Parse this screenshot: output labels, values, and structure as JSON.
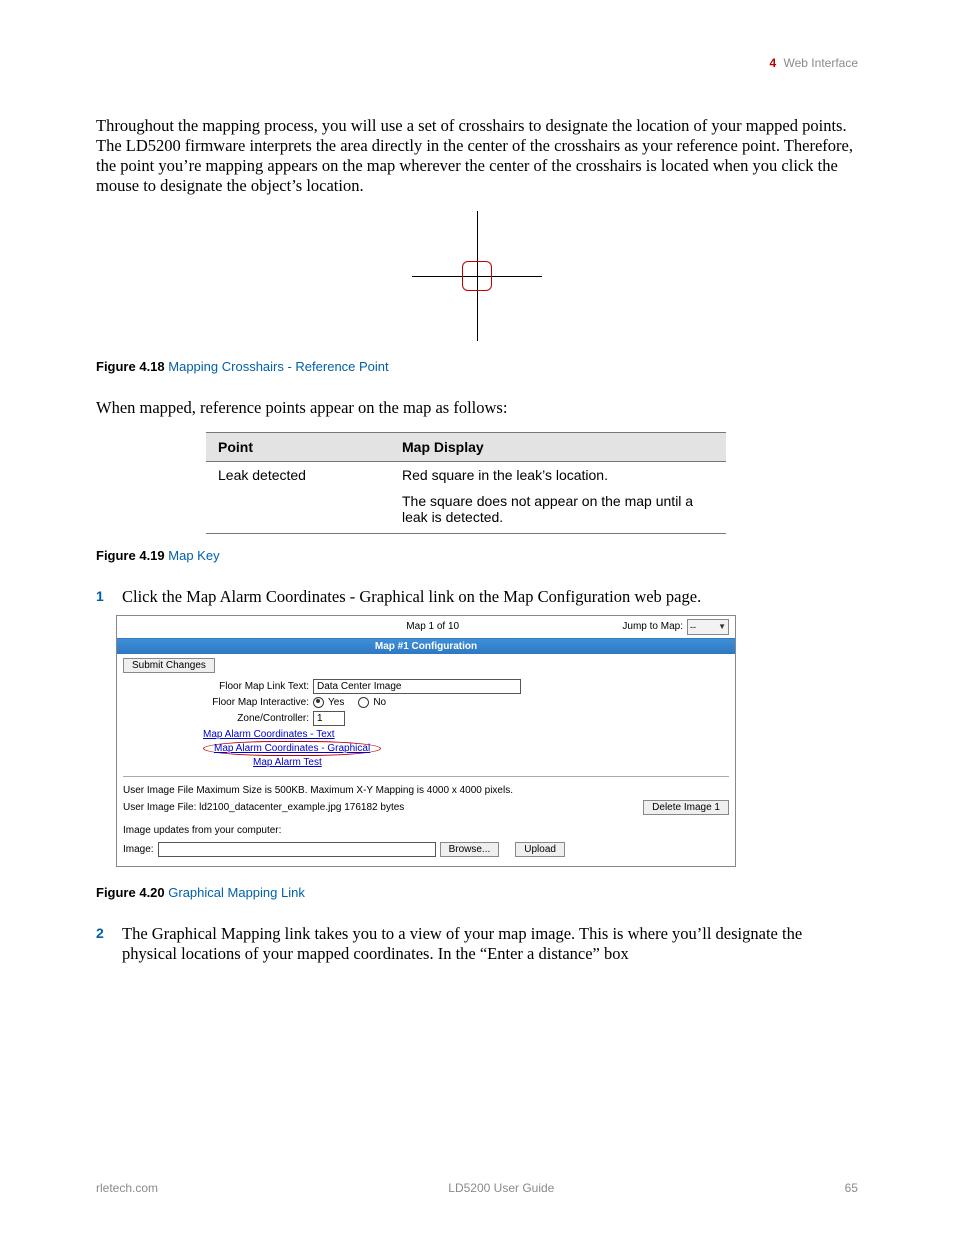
{
  "header": {
    "chapter_num": "4",
    "chapter_title": "Web Interface"
  },
  "para1": "Throughout the mapping process, you will use a set of crosshairs to designate the location of your mapped points. The LD5200 firmware interprets the area directly in the center of the crosshairs as your reference point. Therefore, the point you’re mapping appears on the map wherever the center of the crosshairs is located when you click the mouse to designate the object’s location.",
  "figure18": {
    "label": "Figure 4.18",
    "title": "Mapping Crosshairs - Reference Point"
  },
  "para2": "When mapped, reference points appear on the map as follows:",
  "mapkey": {
    "head_point": "Point",
    "head_display": "Map Display",
    "r1_point": "Leak detected",
    "r1_display": "Red square in the leak’s location.",
    "r2_display": "The square does not appear on the map until a leak is detected."
  },
  "figure19": {
    "label": "Figure 4.19",
    "title": "Map Key"
  },
  "step1": {
    "num": "1",
    "text": "Click the Map Alarm Coordinates - Graphical link on the Map Configuration web page."
  },
  "shot": {
    "top_center": "Map 1 of 10",
    "jump_label": "Jump to Map:",
    "jump_value": "--",
    "bluebar": "Map #1 Configuration",
    "submit": "Submit Changes",
    "fml_text_lbl": "Floor Map Link Text:",
    "fml_text_val": "Data Center Image",
    "fmi_lbl": "Floor Map Interactive:",
    "yes": "Yes",
    "no": "No",
    "zone_lbl": "Zone/Controller:",
    "zone_val": "1",
    "link_text": "Map Alarm Coordinates - Text",
    "link_graphical": "Map Alarm Coordinates - Graphical",
    "link_test": "Map Alarm Test",
    "note1": "User Image File Maximum Size is 500KB. Maximum X-Y Mapping is 4000 x 4000 pixels.",
    "note2": "User Image File: ld2100_datacenter_example.jpg 176182 bytes",
    "delete_btn": "Delete Image 1",
    "note3": "Image updates from your computer:",
    "image_lbl": "Image:",
    "browse": "Browse...",
    "upload": "Upload"
  },
  "figure20": {
    "label": "Figure 4.20",
    "title": "Graphical Mapping Link"
  },
  "step2": {
    "num": "2",
    "text": "The Graphical Mapping link takes you to a view of your map image. This is where you’ll designate the physical locations of your mapped coordinates. In the “Enter a distance” box"
  },
  "footer": {
    "left": "rletech.com",
    "center": "LD5200 User Guide",
    "right": "65"
  }
}
